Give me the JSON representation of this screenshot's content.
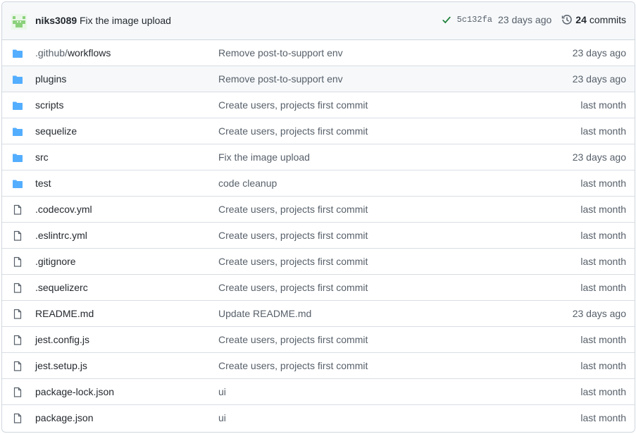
{
  "header": {
    "author": "niks3089",
    "message": "Fix the image upload",
    "sha": "5c132fa",
    "age": "23 days ago",
    "commits_count": "24",
    "commits_label": "commits",
    "status_icon": "check-icon",
    "history_icon": "history-icon",
    "colors": {
      "check": "#1a7f37",
      "folder": "#54aeff"
    }
  },
  "rows": [
    {
      "type": "dir",
      "name_prefix": ".github/",
      "name": "workflows",
      "message": "Remove post-to-support env",
      "age": "23 days ago"
    },
    {
      "type": "dir",
      "name_prefix": "",
      "name": "plugins",
      "message": "Remove post-to-support env",
      "age": "23 days ago"
    },
    {
      "type": "dir",
      "name_prefix": "",
      "name": "scripts",
      "message": "Create users, projects first commit",
      "age": "last month"
    },
    {
      "type": "dir",
      "name_prefix": "",
      "name": "sequelize",
      "message": "Create users, projects first commit",
      "age": "last month"
    },
    {
      "type": "dir",
      "name_prefix": "",
      "name": "src",
      "message": "Fix the image upload",
      "age": "23 days ago"
    },
    {
      "type": "dir",
      "name_prefix": "",
      "name": "test",
      "message": "code cleanup",
      "age": "last month"
    },
    {
      "type": "file",
      "name_prefix": "",
      "name": ".codecov.yml",
      "message": "Create users, projects first commit",
      "age": "last month"
    },
    {
      "type": "file",
      "name_prefix": "",
      "name": ".eslintrc.yml",
      "message": "Create users, projects first commit",
      "age": "last month"
    },
    {
      "type": "file",
      "name_prefix": "",
      "name": ".gitignore",
      "message": "Create users, projects first commit",
      "age": "last month"
    },
    {
      "type": "file",
      "name_prefix": "",
      "name": ".sequelizerc",
      "message": "Create users, projects first commit",
      "age": "last month"
    },
    {
      "type": "file",
      "name_prefix": "",
      "name": "README.md",
      "message": "Update README.md",
      "age": "23 days ago"
    },
    {
      "type": "file",
      "name_prefix": "",
      "name": "jest.config.js",
      "message": "Create users, projects first commit",
      "age": "last month"
    },
    {
      "type": "file",
      "name_prefix": "",
      "name": "jest.setup.js",
      "message": "Create users, projects first commit",
      "age": "last month"
    },
    {
      "type": "file",
      "name_prefix": "",
      "name": "package-lock.json",
      "message": "ui",
      "age": "last month"
    },
    {
      "type": "file",
      "name_prefix": "",
      "name": "package.json",
      "message": "ui",
      "age": "last month"
    }
  ]
}
